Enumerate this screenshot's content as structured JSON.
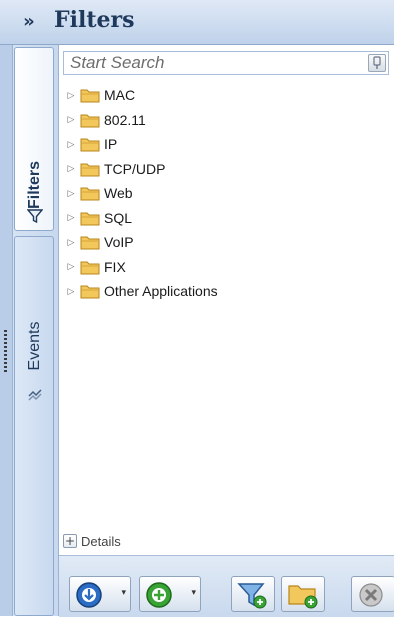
{
  "header": {
    "title": "Filters",
    "collapse_glyph": "»"
  },
  "tabs": [
    {
      "label": "Filters",
      "icon": "filter-icon",
      "active": true
    },
    {
      "label": "Events",
      "icon": "events-icon",
      "active": false
    }
  ],
  "search": {
    "placeholder": "Start Search",
    "value": ""
  },
  "tree": {
    "items": [
      {
        "label": "MAC"
      },
      {
        "label": "802.11"
      },
      {
        "label": "IP"
      },
      {
        "label": "TCP/UDP"
      },
      {
        "label": "Web"
      },
      {
        "label": "SQL"
      },
      {
        "label": "VoIP"
      },
      {
        "label": "FIX"
      },
      {
        "label": "Other Applications"
      }
    ]
  },
  "details": {
    "expander": "+",
    "label": "Details"
  },
  "toolbar": {
    "buttons": [
      {
        "name": "import",
        "icon": "import-icon"
      },
      {
        "name": "add",
        "icon": "add-icon"
      },
      {
        "name": "add-filter",
        "icon": "add-filter-icon"
      },
      {
        "name": "add-folder",
        "icon": "add-folder-icon"
      },
      {
        "name": "delete",
        "icon": "delete-icon"
      }
    ],
    "dropdown_glyph": "▾"
  },
  "colors": {
    "header_bg": "#c9d9ee",
    "title": "#1e395b",
    "accent_blue": "#2b6cc4",
    "accent_green": "#3aa335",
    "folder": "#e8b63a"
  }
}
